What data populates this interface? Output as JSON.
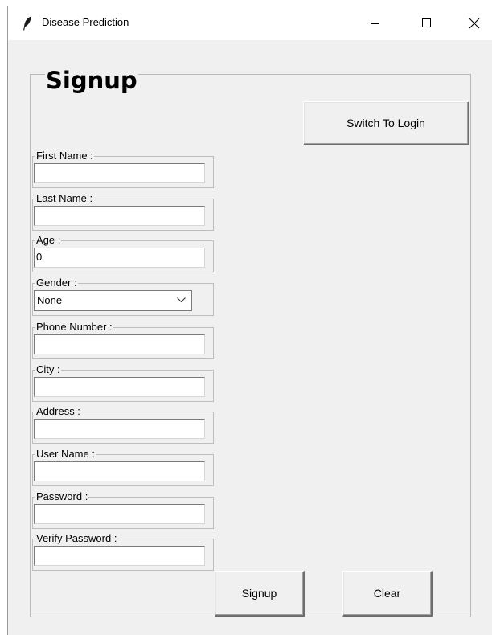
{
  "window": {
    "title": "Disease Prediction",
    "icon": "feather-icon",
    "controls": [
      "minimize-icon",
      "maximize-icon",
      "close-icon"
    ]
  },
  "form": {
    "heading": "Signup",
    "switch_label": "Switch To Login",
    "signup_label": "Signup",
    "clear_label": "Clear"
  },
  "fields": {
    "first_name": {
      "label": "First Name :",
      "value": ""
    },
    "last_name": {
      "label": "Last Name :",
      "value": ""
    },
    "age": {
      "label": "Age :",
      "value": "0"
    },
    "gender": {
      "label": "Gender :",
      "value": "None"
    },
    "phone": {
      "label": "Phone Number :",
      "value": ""
    },
    "city": {
      "label": "City :",
      "value": ""
    },
    "address": {
      "label": "Address :",
      "value": ""
    },
    "username": {
      "label": "User Name :",
      "value": ""
    },
    "password": {
      "label": "Password :",
      "value": ""
    },
    "verify_password": {
      "label": "Verify Password :",
      "value": ""
    }
  }
}
